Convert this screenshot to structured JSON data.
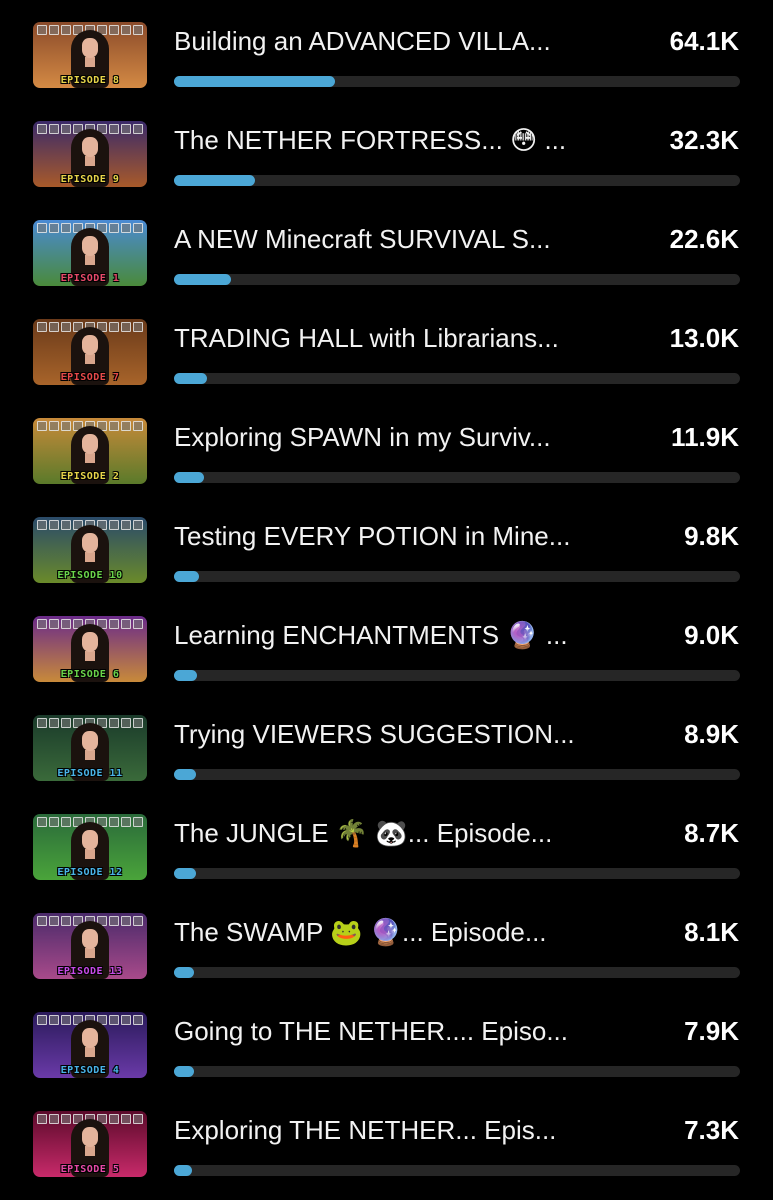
{
  "colors": {
    "background": "#000000",
    "bar_fill": "#4ba7d6",
    "bar_track": "#262626",
    "text": "#ffffff"
  },
  "videos": [
    {
      "title": "Building an ADVANCED VILLA...",
      "views": "64.1K",
      "views_value": 64100,
      "episode_label": "EPISODE 8",
      "episode_color": "#e8d64a",
      "thumb_colors": [
        "#8a4a2a",
        "#d48a44"
      ]
    },
    {
      "title": "The NETHER FORTRESS... 😳 ...",
      "views": "32.3K",
      "views_value": 32300,
      "episode_label": "EPISODE 9",
      "episode_color": "#e8d64a",
      "thumb_colors": [
        "#3a2a6a",
        "#a85a2a"
      ]
    },
    {
      "title": "A NEW Minecraft SURVIVAL S...",
      "views": "22.6K",
      "views_value": 22600,
      "episode_label": "EPISODE 1",
      "episode_color": "#e84a6a",
      "thumb_colors": [
        "#4a8ad4",
        "#4a8a3a"
      ]
    },
    {
      "title": "TRADING HALL with Librarians...",
      "views": "13.0K",
      "views_value": 13000,
      "episode_label": "EPISODE 7",
      "episode_color": "#e84a4a",
      "thumb_colors": [
        "#6a3a1a",
        "#a8642a"
      ]
    },
    {
      "title": "Exploring SPAWN in my Surviv...",
      "views": "11.9K",
      "views_value": 11900,
      "episode_label": "EPISODE 2",
      "episode_color": "#e8d64a",
      "thumb_colors": [
        "#c88a3a",
        "#5a7a2a"
      ]
    },
    {
      "title": "Testing EVERY POTION in Mine...",
      "views": "9.8K",
      "views_value": 9800,
      "episode_label": "EPISODE 10",
      "episode_color": "#6ad44a",
      "thumb_colors": [
        "#2a4a6a",
        "#6a8a2a"
      ]
    },
    {
      "title": "Learning ENCHANTMENTS 🔮 ...",
      "views": "9.0K",
      "views_value": 9000,
      "episode_label": "EPISODE 6",
      "episode_color": "#6ad44a",
      "thumb_colors": [
        "#6a2a8a",
        "#c88a3a"
      ]
    },
    {
      "title": "Trying VIEWERS SUGGESTION...",
      "views": "8.9K",
      "views_value": 8900,
      "episode_label": "EPISODE 11",
      "episode_color": "#4ab4e8",
      "thumb_colors": [
        "#1a3a2a",
        "#3a6a3a"
      ]
    },
    {
      "title": "The JUNGLE 🌴 🐼... Episode...",
      "views": "8.7K",
      "views_value": 8700,
      "episode_label": "EPISODE 12",
      "episode_color": "#4ab4e8",
      "thumb_colors": [
        "#2a6a3a",
        "#4aa43a"
      ]
    },
    {
      "title": "The SWAMP 🐸 🔮... Episode...",
      "views": "8.1K",
      "views_value": 8100,
      "episode_label": "EPISODE 13",
      "episode_color": "#c84ae8",
      "thumb_colors": [
        "#4a2a6a",
        "#a84a8a"
      ]
    },
    {
      "title": "Going to THE NETHER.... Episo...",
      "views": "7.9K",
      "views_value": 7900,
      "episode_label": "EPISODE 4",
      "episode_color": "#4ab4e8",
      "thumb_colors": [
        "#2a1a5a",
        "#6a3aa8"
      ]
    },
    {
      "title": "Exploring THE NETHER... Epis...",
      "views": "7.3K",
      "views_value": 7300,
      "episode_label": "EPISODE 5",
      "episode_color": "#e84aa8",
      "thumb_colors": [
        "#5a0a2a",
        "#c82a6a"
      ]
    }
  ]
}
